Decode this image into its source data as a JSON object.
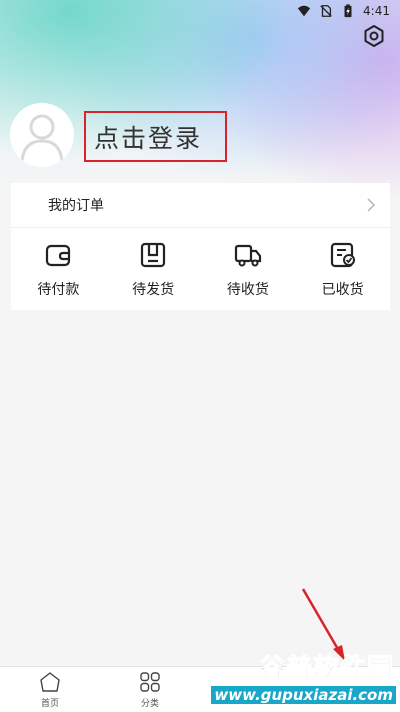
{
  "status_bar": {
    "time": "4:41"
  },
  "profile": {
    "login_label": "点击登录"
  },
  "orders": {
    "title": "我的订单",
    "items": [
      {
        "label": "待付款",
        "icon": "wallet-icon"
      },
      {
        "label": "待发货",
        "icon": "package-icon"
      },
      {
        "label": "待收货",
        "icon": "delivery-truck-icon"
      },
      {
        "label": "已收货",
        "icon": "received-check-icon"
      }
    ]
  },
  "tab_bar": {
    "tabs": [
      {
        "label": "首页",
        "icon": "home-icon"
      },
      {
        "label": "分类",
        "icon": "category-grid-icon"
      }
    ]
  },
  "watermark": {
    "title": "谷普软件园",
    "url": "www.gupuxiazai.com"
  },
  "colors": {
    "highlight_border": "#d6242a",
    "arrow": "#d6242a",
    "watermark": "#18a7c9"
  }
}
